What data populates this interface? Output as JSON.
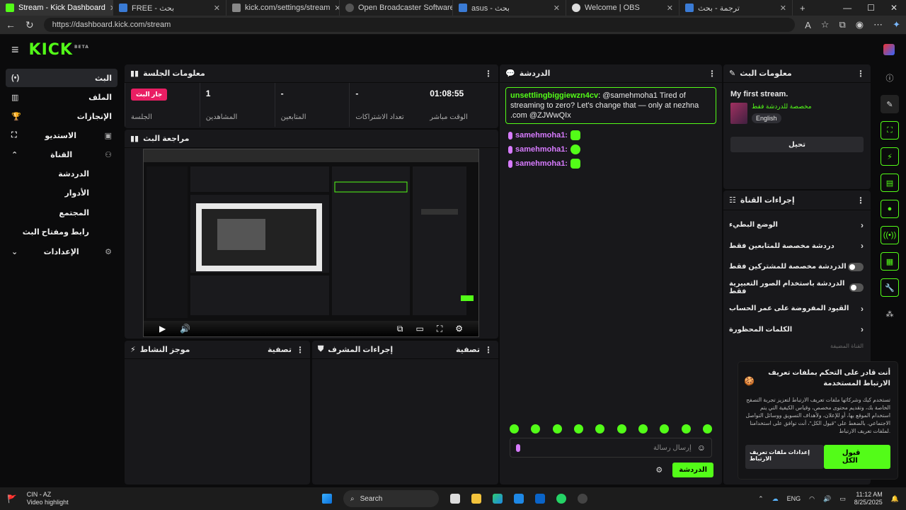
{
  "browser": {
    "tabs": [
      {
        "label": "Stream - Kick Dashboard",
        "active": true
      },
      {
        "label": "FREE - بحث"
      },
      {
        "label": "kick.com/settings/stream"
      },
      {
        "label": "Open Broadcaster Software | OB"
      },
      {
        "label": "asus - بحث"
      },
      {
        "label": "Welcome | OBS"
      },
      {
        "label": "ترجمة - بحث"
      }
    ],
    "url": "https://dashboard.kick.com/stream"
  },
  "app": {
    "logo": "KICK",
    "logo_badge": "BETA"
  },
  "sidebar": {
    "items": [
      {
        "label": "البث",
        "icon": "(•)"
      },
      {
        "label": "الملف",
        "icon": "▥"
      },
      {
        "label": "الإنجازات",
        "icon": "🏆"
      },
      {
        "label": "الاستديو",
        "icon": "⛶"
      },
      {
        "label": "القناة",
        "icon": "⚇"
      }
    ],
    "channel_sub": [
      "الدردشة",
      "الأدوار",
      "المجتمع",
      "رابط ومفتاح البث"
    ],
    "settings": {
      "label": "الإعدادات",
      "icon": "⚙"
    }
  },
  "session": {
    "title": "معلومات الجلسة",
    "live_badge": "جار البث",
    "live_label": "الجلسة",
    "viewers_value": "1",
    "viewers_label": "المشاهدين",
    "followers_value": "-",
    "followers_label": "المتابعين",
    "subs_value": "-",
    "subs_label": "تعداد الاشتراكات",
    "time_value": "01:08:55",
    "time_label": "الوقت مباشر"
  },
  "preview": {
    "title": "مراجعة البث"
  },
  "activity": {
    "title": "موجز النشاط",
    "filter": "تصفية"
  },
  "mod": {
    "title": "إجراءات المشرف",
    "filter": "تصفية"
  },
  "chat": {
    "title": "الدردشة",
    "highlight_user": "unsettlingbiggiewzn4cv",
    "highlight_text": "@samehmoha1 Tired of streaming to zero? Let's change that — only at nezhna .com @ZJWwQIx",
    "lines": [
      "samehmoha1:",
      "samehmoha1:",
      "samehmoha1:"
    ],
    "input_placeholder": "إرسال رسالة",
    "send_button": "الدردشة"
  },
  "stream_info": {
    "title": "معلومات البث",
    "stream_title": "My first stream.",
    "category": "مخصصة للدردشة فقط",
    "language": "English",
    "edit_button": "تحيل"
  },
  "channel_actions": {
    "title": "إجراءات القناة",
    "items": [
      {
        "label": "الوضع البطيء",
        "kind": "chevron"
      },
      {
        "label": "دردشة مخصصة للمتابعين فقط",
        "kind": "chevron"
      },
      {
        "label": "الدردشة مخصصة للمشتركين فقط",
        "kind": "toggle"
      },
      {
        "label": "الدردشة باستخدام الصور التعبيرية فقط",
        "kind": "toggle"
      },
      {
        "label": "القيود المفروضة على عمر الحساب",
        "kind": "chevron"
      },
      {
        "label": "الكلمات المحظورة",
        "kind": "chevron"
      }
    ],
    "faded": "القناة المضيفة"
  },
  "cookie": {
    "title": "أنت قادر على التحكم بملفات تعريف الارتباط المستخدمة",
    "body": "تستخدم كيك وشركائها ملفات تعريف الارتباط لتعزيز تجربة التصفح الخاصة بك، وتقديم محتوى مخصص، وقياس الكيفية التي يتم استخدام الموقع بها، أو للإعلان، ولأهداف التسويق ووسائل التواصل الاجتماعي. بالضغط على \"قبول الكل\"، أنت توافق على استخدامنا لملفات تعريف الارتباط.",
    "settings_button": "إعدادات ملفات تعريف الارتباط",
    "accept_button": "قبول الكل"
  },
  "taskbar": {
    "weather_title": "CIN - AZ",
    "weather_sub": "Video highlight",
    "search": "Search",
    "lang": "ENG",
    "time": "11:12 AM",
    "date": "8/25/2025"
  },
  "colors": {
    "accent": "#53fc18",
    "live": "#e91e63",
    "panel": "#18181b"
  }
}
